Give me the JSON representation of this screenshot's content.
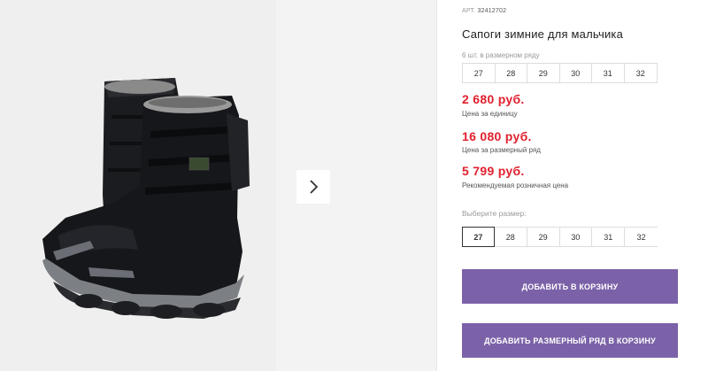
{
  "product": {
    "sku_label": "АРТ.",
    "sku_value": "32412702",
    "title": "Сапоги зимние для мальчика",
    "pack_note": "6 шт. в размерном ряду",
    "pack_sizes": [
      "27",
      "28",
      "29",
      "30",
      "31",
      "32"
    ],
    "prices": [
      {
        "amount": "2 680 руб.",
        "note": "Цена за единицу"
      },
      {
        "amount": "16 080 руб.",
        "note": "Цена за размерный ряд"
      },
      {
        "amount": "5 799 руб.",
        "note": "Рекомендуемая розничная цена"
      }
    ],
    "choose_size_label": "Выберите размер:",
    "sizes": [
      "27",
      "28",
      "29",
      "30",
      "31",
      "32"
    ],
    "selected_size": "27"
  },
  "buttons": {
    "add_to_cart": "ДОБАВИТЬ В КОРЗИНУ",
    "add_pack_to_cart": "ДОБАВИТЬ РАЗМЕРНЫЙ РЯД В КОРЗИНУ"
  },
  "icons": {
    "next": "chevron-right-icon"
  },
  "colors": {
    "price_red": "#e1202e",
    "button_purple": "#7b62a8",
    "gallery_bg": "#efefef"
  }
}
